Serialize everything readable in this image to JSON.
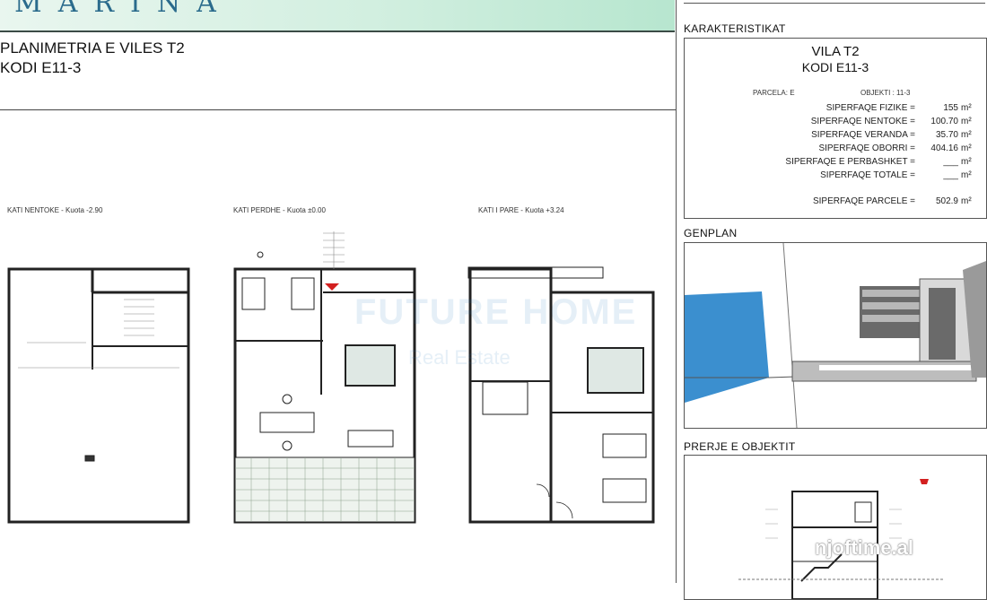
{
  "header": {
    "brand": "MARINA"
  },
  "document": {
    "title_line1": "PLANIMETRIA E VILES T2",
    "title_line2": "KODI E11-3"
  },
  "floor_plans": [
    {
      "label": "KATI NENTOKE - Kuota -2.90"
    },
    {
      "label": "KATI PERDHE - Kuota ±0.00"
    },
    {
      "label": "KATI I PARE - Kuota +3.24"
    }
  ],
  "characteristics": {
    "section_title": "KARAKTERISTIKAT",
    "vila": "VILA T2",
    "kodi": "KODI E11-3",
    "parcela": "PARCELA: E",
    "objekti": "OBJEKTI : 11-3",
    "rows": [
      {
        "label": "SIPERFAQE  FIZIKE  =",
        "value": "155",
        "unit": "m²"
      },
      {
        "label": "SIPERFAQE  NENTOKE  =",
        "value": "100.70",
        "unit": "m²"
      },
      {
        "label": "SIPERFAQE  VERANDA  =",
        "value": "35.70",
        "unit": "m²"
      },
      {
        "label": "SIPERFAQE  OBORRI  =",
        "value": "404.16",
        "unit": "m²"
      },
      {
        "label": "SIPERFAQE E PERBASHKET  =",
        "value": "___",
        "unit": "m²"
      },
      {
        "label": "SIPERFAQE TOTALE  =",
        "value": "___",
        "unit": "m²"
      }
    ],
    "parcel_row": {
      "label": "SIPERFAQE PARCELE  =",
      "value": "502.9",
      "unit": "m²"
    }
  },
  "genplan": {
    "section_title": "GENPLAN"
  },
  "section": {
    "section_title": "PRERJE E OBJEKTIT"
  },
  "watermarks": {
    "site": "njoftime.al",
    "agency": "FUTURE HOME",
    "agency_sub": "Real Estate"
  },
  "colors": {
    "banner": "#d2efe0",
    "brand": "#2a6b8c",
    "sea": "#3b8fcf",
    "red_marker": "#d32020"
  }
}
